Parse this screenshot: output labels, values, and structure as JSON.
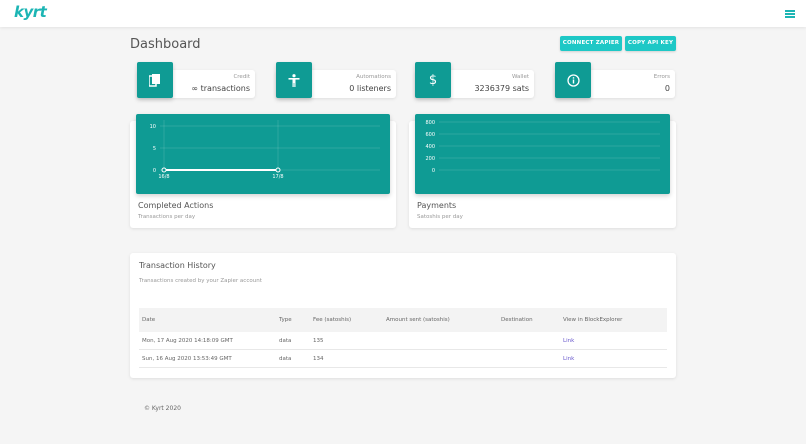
{
  "app": {
    "logo": "kyrt"
  },
  "header": {
    "title": "Dashboard",
    "connect_zapier": "CONNECT ZAPIER",
    "copy_api_key": "COPY API KEY"
  },
  "stats": [
    {
      "label": "Credit",
      "value": "∞ transactions",
      "icon": "file-copy-icon"
    },
    {
      "label": "Automations",
      "value": "0 listeners",
      "icon": "accessibility-icon"
    },
    {
      "label": "Wallet",
      "value": "3236379 sats",
      "icon": "dollar-icon"
    },
    {
      "label": "Errors",
      "value": "0",
      "icon": "info-icon"
    }
  ],
  "charts": [
    {
      "title": "Completed Actions",
      "subtitle": "Transactions per day"
    },
    {
      "title": "Payments",
      "subtitle": "Satoshis per day"
    }
  ],
  "chart_data": [
    {
      "type": "line",
      "title": "Completed Actions",
      "subtitle": "Transactions per day",
      "x": [
        "16/8",
        "17/8"
      ],
      "series": [
        {
          "values": [
            0,
            0
          ]
        }
      ],
      "ylim": [
        0,
        10
      ],
      "yticks": [
        0,
        5,
        10
      ],
      "grid": true
    },
    {
      "type": "line",
      "title": "Payments",
      "subtitle": "Satoshis per day",
      "x": [],
      "series": [],
      "ylim": [
        0,
        800
      ],
      "yticks": [
        0,
        200,
        400,
        600,
        800
      ],
      "grid": true
    }
  ],
  "history": {
    "title": "Transaction History",
    "subtitle": "Transactions created by your Zapier account",
    "columns": [
      "Date",
      "Type",
      "Fee (satoshis)",
      "Amount sent (satoshis)",
      "Destination",
      "View in BlockExplorer"
    ],
    "rows": [
      {
        "date": "Mon, 17 Aug 2020 14:18:09 GMT",
        "type": "data",
        "fee": "135",
        "amount": "",
        "destination": "",
        "link": "Link"
      },
      {
        "date": "Sun, 16 Aug 2020 13:53:49 GMT",
        "type": "data",
        "fee": "134",
        "amount": "",
        "destination": "",
        "link": "Link"
      }
    ]
  },
  "footer": {
    "text": "© Kyrt 2020"
  },
  "colors": {
    "accent": "#1ec8c6",
    "chart_bg": "#0f9b94",
    "brand": "#1cb5b4"
  }
}
